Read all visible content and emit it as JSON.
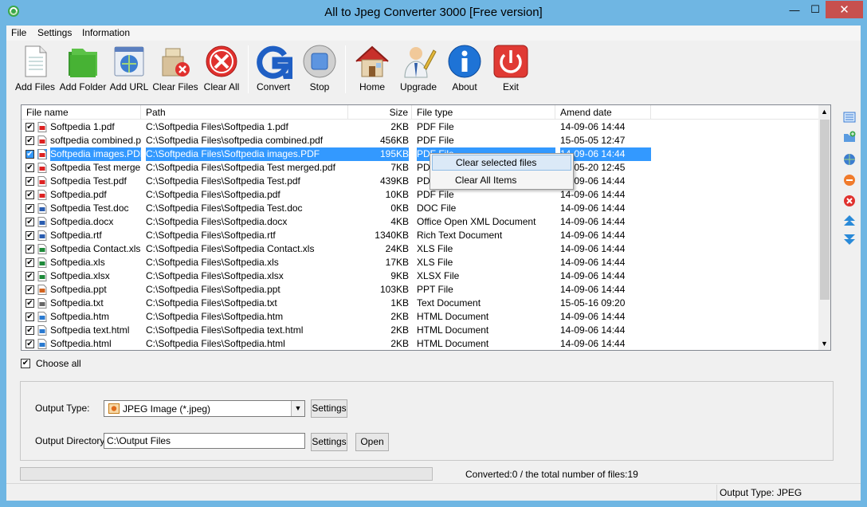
{
  "window": {
    "title": "All to Jpeg Converter 3000 [Free version]",
    "minimize": "—",
    "maximize": "☐",
    "close": "✕"
  },
  "menu": [
    "File",
    "Settings",
    "Information"
  ],
  "toolbar": [
    {
      "label": "Add Files",
      "icon": "add-files-icon"
    },
    {
      "label": "Add Folder",
      "icon": "add-folder-icon"
    },
    {
      "label": "Add URL",
      "icon": "add-url-icon"
    },
    {
      "label": "Clear Files",
      "icon": "clear-files-icon"
    },
    {
      "label": "Clear All",
      "icon": "clear-all-icon"
    },
    {
      "label": "Convert",
      "icon": "convert-icon"
    },
    {
      "label": "Stop",
      "icon": "stop-icon"
    },
    {
      "label": "Home",
      "icon": "home-icon"
    },
    {
      "label": "Upgrade",
      "icon": "upgrade-icon"
    },
    {
      "label": "About",
      "icon": "about-icon"
    },
    {
      "label": "Exit",
      "icon": "exit-icon"
    }
  ],
  "list": {
    "columns": [
      "File name",
      "Path",
      "Size",
      "File type",
      "Amend date"
    ],
    "rows": [
      {
        "checked": true,
        "icon": "pdf",
        "name": "Softpedia 1.pdf",
        "path": "C:\\Softpedia Files\\Softpedia 1.pdf",
        "size": "2KB",
        "type": "PDF File",
        "date": "14-09-06 14:44"
      },
      {
        "checked": true,
        "icon": "pdf",
        "name": "softpedia combined.pdf",
        "path": "C:\\Softpedia Files\\softpedia combined.pdf",
        "size": "456KB",
        "type": "PDF File",
        "date": "15-05-05 12:47"
      },
      {
        "checked": true,
        "icon": "pdf",
        "name": "Softpedia images.PDF",
        "path": "C:\\Softpedia Files\\Softpedia images.PDF",
        "size": "195KB",
        "type": "PDF File",
        "date": "14-09-06 14:44",
        "selected": true
      },
      {
        "checked": true,
        "icon": "pdf",
        "name": "Softpedia Test merge...",
        "path": "C:\\Softpedia Files\\Softpedia Test merged.pdf",
        "size": "7KB",
        "type": "PDF File",
        "date": "15-05-20 12:45"
      },
      {
        "checked": true,
        "icon": "pdf",
        "name": "Softpedia Test.pdf",
        "path": "C:\\Softpedia Files\\Softpedia Test.pdf",
        "size": "439KB",
        "type": "PDF File",
        "date": "14-09-06 14:44"
      },
      {
        "checked": true,
        "icon": "pdf",
        "name": "Softpedia.pdf",
        "path": "C:\\Softpedia Files\\Softpedia.pdf",
        "size": "10KB",
        "type": "PDF File",
        "date": "14-09-06 14:44"
      },
      {
        "checked": true,
        "icon": "doc",
        "name": "Softpedia Test.doc",
        "path": "C:\\Softpedia Files\\Softpedia Test.doc",
        "size": "0KB",
        "type": "DOC File",
        "date": "14-09-06 14:44"
      },
      {
        "checked": true,
        "icon": "doc",
        "name": "Softpedia.docx",
        "path": "C:\\Softpedia Files\\Softpedia.docx",
        "size": "4KB",
        "type": "Office Open XML Document",
        "date": "14-09-06 14:44"
      },
      {
        "checked": true,
        "icon": "doc",
        "name": "Softpedia.rtf",
        "path": "C:\\Softpedia Files\\Softpedia.rtf",
        "size": "1340KB",
        "type": "Rich Text Document",
        "date": "14-09-06 14:44"
      },
      {
        "checked": true,
        "icon": "xls",
        "name": "Softpedia Contact.xls",
        "path": "C:\\Softpedia Files\\Softpedia Contact.xls",
        "size": "24KB",
        "type": "XLS File",
        "date": "14-09-06 14:44"
      },
      {
        "checked": true,
        "icon": "xls",
        "name": "Softpedia.xls",
        "path": "C:\\Softpedia Files\\Softpedia.xls",
        "size": "17KB",
        "type": "XLS File",
        "date": "14-09-06 14:44"
      },
      {
        "checked": true,
        "icon": "xls",
        "name": "Softpedia.xlsx",
        "path": "C:\\Softpedia Files\\Softpedia.xlsx",
        "size": "9KB",
        "type": "XLSX File",
        "date": "14-09-06 14:44"
      },
      {
        "checked": true,
        "icon": "ppt",
        "name": "Softpedia.ppt",
        "path": "C:\\Softpedia Files\\Softpedia.ppt",
        "size": "103KB",
        "type": "PPT File",
        "date": "14-09-06 14:44"
      },
      {
        "checked": true,
        "icon": "txt",
        "name": "Softpedia.txt",
        "path": "C:\\Softpedia Files\\Softpedia.txt",
        "size": "1KB",
        "type": "Text Document",
        "date": "15-05-16 09:20"
      },
      {
        "checked": true,
        "icon": "htm",
        "name": "Softpedia.htm",
        "path": "C:\\Softpedia Files\\Softpedia.htm",
        "size": "2KB",
        "type": "HTML Document",
        "date": "14-09-06 14:44"
      },
      {
        "checked": true,
        "icon": "htm",
        "name": "Softpedia text.html",
        "path": "C:\\Softpedia Files\\Softpedia text.html",
        "size": "2KB",
        "type": "HTML Document",
        "date": "14-09-06 14:44"
      },
      {
        "checked": true,
        "icon": "htm",
        "name": "Softpedia.html",
        "path": "C:\\Softpedia Files\\Softpedia.html",
        "size": "2KB",
        "type": "HTML Document",
        "date": "14-09-06 14:44"
      }
    ]
  },
  "context_menu": [
    "Clear selected files",
    "Clear All Items"
  ],
  "choose_all": {
    "label": "Choose all",
    "checked": true
  },
  "output": {
    "type_label": "Output Type:",
    "type_value": "JPEG Image (*.jpeg)",
    "settings_label": "Settings",
    "dir_label": "Output Directory:",
    "dir_value": "C:\\Output Files",
    "dir_settings_label": "Settings",
    "open_label": "Open"
  },
  "progress": 0,
  "status": {
    "converted": "Converted:0  /  the total number of files:19",
    "output_type": "Output Type: JPEG"
  },
  "side_tools": [
    "list-view-icon",
    "add-folder-small-icon",
    "globe-icon",
    "remove-icon",
    "clear-icon",
    "move-up-icon",
    "move-down-icon"
  ],
  "colors": {
    "titlebar": "#6fb6e3",
    "selection": "#3399ff",
    "close": "#c7504e"
  }
}
